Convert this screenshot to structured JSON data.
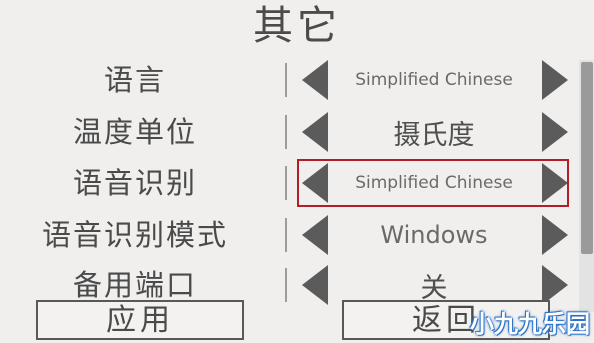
{
  "title": "其它",
  "settings": [
    {
      "label": "语言",
      "value": "Simplified Chinese"
    },
    {
      "label": "温度单位",
      "value": "摄氏度"
    },
    {
      "label": "语音识别",
      "value": "Simplified Chinese"
    },
    {
      "label": "语音识别模式",
      "value": "Windows"
    },
    {
      "label": "备用端口",
      "value": "关"
    }
  ],
  "buttons": {
    "apply": "应用",
    "back": "返回"
  },
  "watermark": "小九九乐园",
  "colors": {
    "background": "#f0efed",
    "text": "#4a4a4a",
    "arrow": "#5b5b5b",
    "highlight_border": "#b21e26",
    "watermark": "#2f74c9"
  },
  "icons": {
    "left": "left-arrow-icon",
    "right": "right-arrow-icon"
  }
}
